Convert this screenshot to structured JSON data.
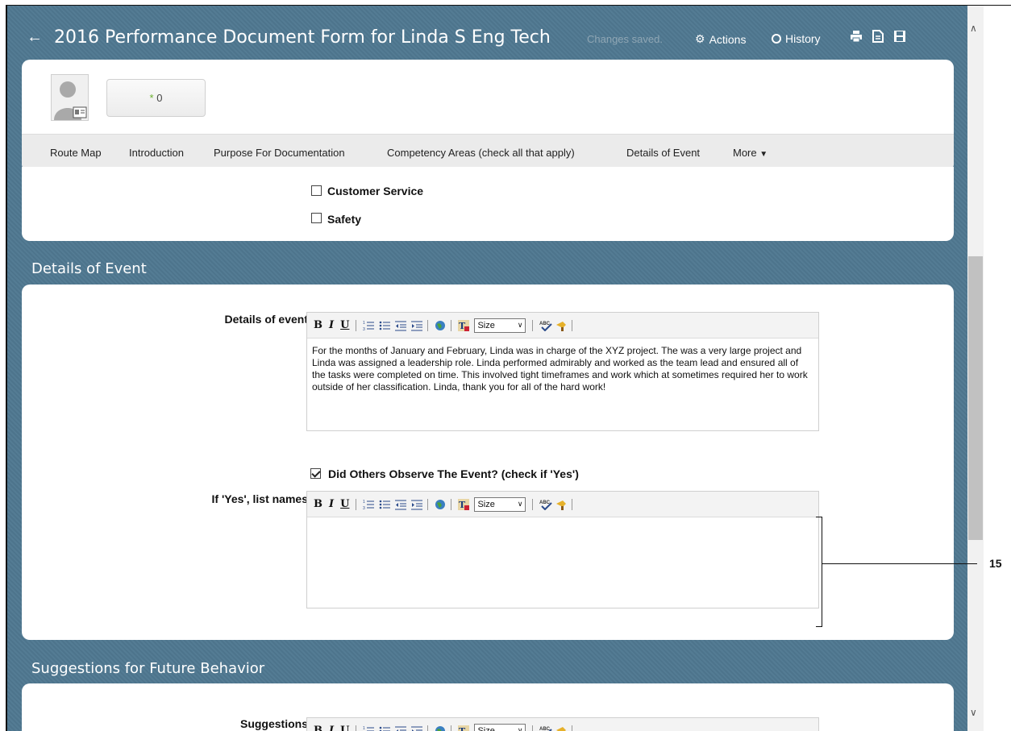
{
  "title_bar": {
    "title": "2016 Performance Document Form for Linda S Eng Tech",
    "status": "Changes saved.",
    "actions_label": "Actions",
    "history_label": "History"
  },
  "header": {
    "rating_star": "*",
    "rating_value": "0"
  },
  "nav": {
    "items": [
      "Route Map",
      "Introduction",
      "Purpose For Documentation",
      "Competency Areas (check all that apply)",
      "Details of Event"
    ],
    "more_label": "More"
  },
  "competency": {
    "items": [
      {
        "label": "Customer Service",
        "checked": false
      },
      {
        "label": "Safety",
        "checked": false
      }
    ]
  },
  "details_section": {
    "title": "Details of Event",
    "details_label": "Details of event",
    "details_text": "For the months of January and February, Linda was in charge of the XYZ project.  The was a very large project and Linda was assigned a leadership role.  Linda performed admirably and worked as the team lead and ensured all of the tasks were completed on time.  This involved tight timeframes and work which at sometimes required her to work outside of her classification.  Linda, thank you for all of the hard work!",
    "observe_label": "Did Others Observe The Event? (check if 'Yes')",
    "observe_checked": true,
    "names_label": "If 'Yes', list names",
    "names_text": ""
  },
  "suggestions_section": {
    "title": "Suggestions for Future Behavior",
    "suggestions_label": "Suggestions"
  },
  "toolbar": {
    "bold": "B",
    "italic": "I",
    "underline": "U",
    "size_label": "Size"
  },
  "callout": {
    "number": "15"
  }
}
